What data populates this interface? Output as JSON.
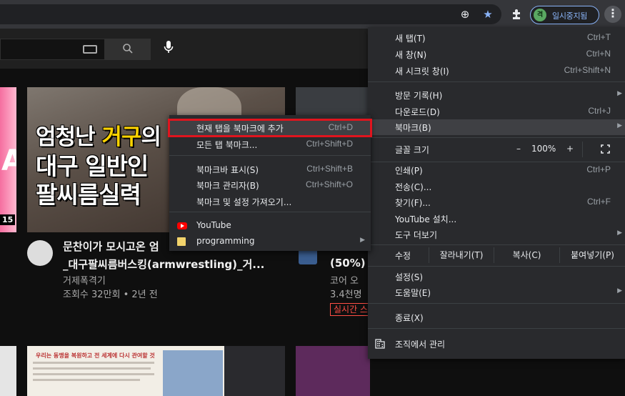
{
  "toolbar": {
    "profile_label": "일시중지됨",
    "profile_initial": "격",
    "menu_glyph": "⋮"
  },
  "youtube": {
    "video1": {
      "thumb_line1_a": "엄청난 ",
      "thumb_line1_b": "거구",
      "thumb_line1_c": "의",
      "thumb_line2": "대구 일반인",
      "thumb_line3": "팔씨름실력",
      "title_line1": "문찬이가 모시고온 엄",
      "title_line2": "_대구팔씨름버스킹(armwrestling)_거...",
      "channel": "거제폭격기",
      "stats": "조회수 32만회 • 2년 전"
    },
    "video2": {
      "title": "(50%)",
      "channel": "코어 오",
      "stats": "3.4천명",
      "live_badge": "실시간 스"
    },
    "left_duration": "15",
    "left_letter": "A",
    "thumb_row2_text": "우리는 동맹을 복원하고 전 세계에 다시 관여할 것"
  },
  "main_menu": {
    "items_top": [
      {
        "label": "새 탭(T)",
        "shortcut": "Ctrl+T"
      },
      {
        "label": "새 창(N)",
        "shortcut": "Ctrl+N"
      },
      {
        "label": "새 시크릿 창(I)",
        "shortcut": "Ctrl+Shift+N"
      }
    ],
    "items_history": [
      {
        "label": "방문 기록(H)",
        "shortcut": ""
      },
      {
        "label": "다운로드(D)",
        "shortcut": "Ctrl+J"
      },
      {
        "label": "북마크(B)",
        "shortcut": ""
      }
    ],
    "zoom": {
      "label": "글꼴 크기",
      "minus": "–",
      "value": "100%",
      "plus": "+"
    },
    "items_tools": [
      {
        "label": "인쇄(P)",
        "shortcut": "Ctrl+P"
      },
      {
        "label": "전송(C)...",
        "shortcut": ""
      },
      {
        "label": "찾기(F)...",
        "shortcut": "Ctrl+F"
      },
      {
        "label": "YouTube 설치...",
        "shortcut": ""
      },
      {
        "label": "도구 더보기",
        "shortcut": ""
      }
    ],
    "edit": {
      "label": "수정",
      "cut": "잘라내기(T)",
      "copy": "복사(C)",
      "paste": "붙여넣기(P)"
    },
    "items_settings": [
      {
        "label": "설정(S)"
      },
      {
        "label": "도움말(E)"
      }
    ],
    "exit": "종료(X)",
    "managed": "조직에서 관리"
  },
  "bookmarks_menu": {
    "items": [
      {
        "label": "현재 탭을 북마크에 추가",
        "shortcut": "Ctrl+D"
      },
      {
        "label": "모든 탭 북마크...",
        "shortcut": "Ctrl+Shift+D"
      },
      {
        "label": "북마크바 표시(S)",
        "shortcut": "Ctrl+Shift+B"
      },
      {
        "label": "북마크 관리자(B)",
        "shortcut": "Ctrl+Shift+O"
      },
      {
        "label": "북마크 및 설정 가져오기...",
        "shortcut": ""
      }
    ],
    "bookmarks": [
      {
        "label": "YouTube",
        "icon": "youtube-icon"
      },
      {
        "label": "programming",
        "icon": "folder-icon"
      }
    ]
  },
  "colors": {
    "menu_bg": "#292a2d",
    "highlight_outline": "#e0141e",
    "accent": "#8ab4f8"
  }
}
